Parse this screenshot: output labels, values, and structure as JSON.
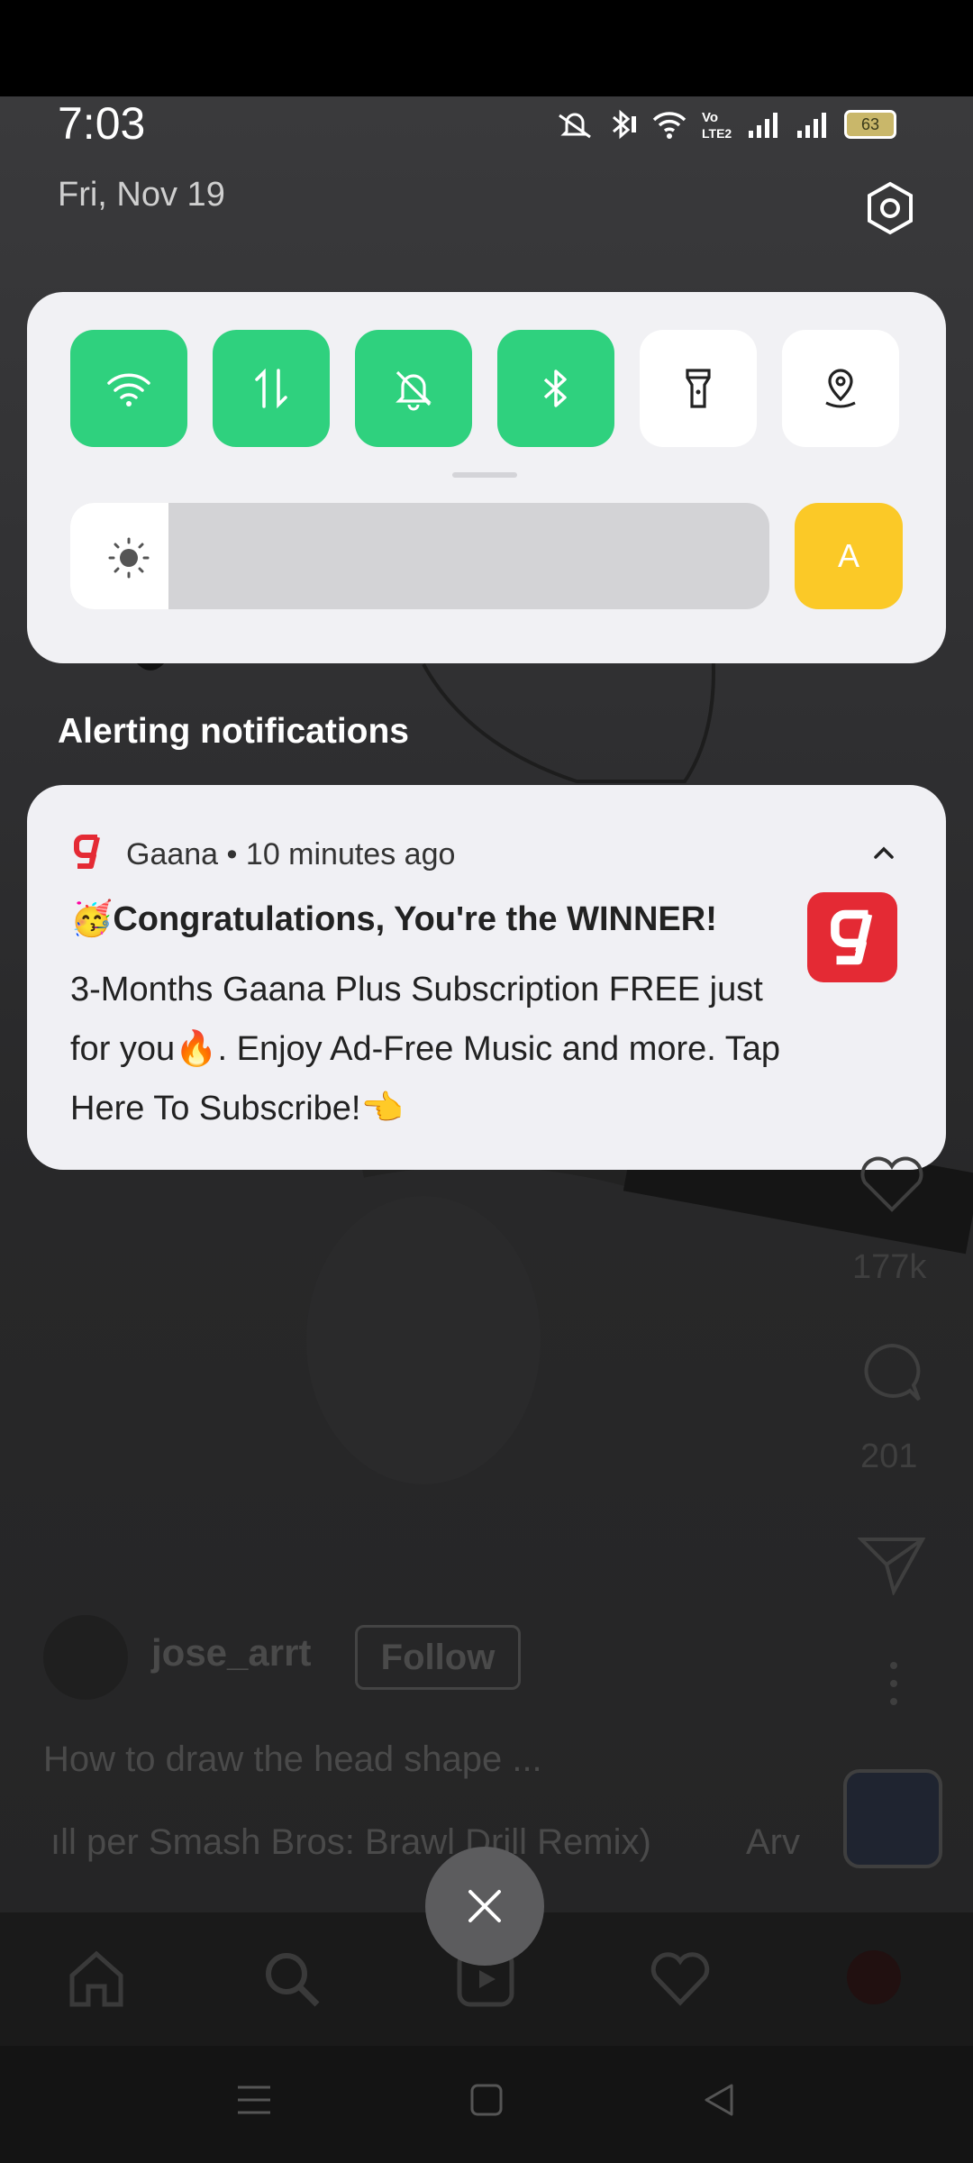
{
  "status_bar": {
    "time": "7:03",
    "date": "Fri, Nov 19",
    "battery": "63"
  },
  "quick_settings": {
    "tiles": [
      {
        "name": "wifi",
        "icon": "wifi-icon",
        "state": "on"
      },
      {
        "name": "mobile-data",
        "icon": "data-arrows-icon",
        "state": "on"
      },
      {
        "name": "mute",
        "icon": "bell-off-icon",
        "state": "on"
      },
      {
        "name": "bluetooth",
        "icon": "bluetooth-icon",
        "state": "on"
      },
      {
        "name": "flashlight",
        "icon": "flashlight-icon",
        "state": "off"
      },
      {
        "name": "location",
        "icon": "location-pin-icon",
        "state": "off"
      }
    ],
    "brightness_level": 0.14,
    "auto_brightness_label": "A",
    "accent_color": "#2fd17e",
    "auto_color": "#fbc927"
  },
  "notifications": {
    "section_title": "Alerting notifications",
    "items": [
      {
        "app": "Gaana",
        "separator": "•",
        "time_ago": "10 minutes ago",
        "title": "🥳Congratulations, You're the WINNER!",
        "body": "3-Months Gaana Plus Subscription FREE just for you🔥. Enjoy Ad-Free Music and more. Tap Here To Subscribe!👈",
        "brand_color": "#e42a34"
      }
    ]
  },
  "background_app": {
    "likes": "177k",
    "comments": "201",
    "username": "jose_arrt",
    "follow_label": "Follow",
    "caption": "How to draw the head shape ...",
    "audio": "per Smash Bros: Brawl Drill Remix)",
    "audio_trailing": "Arv"
  }
}
